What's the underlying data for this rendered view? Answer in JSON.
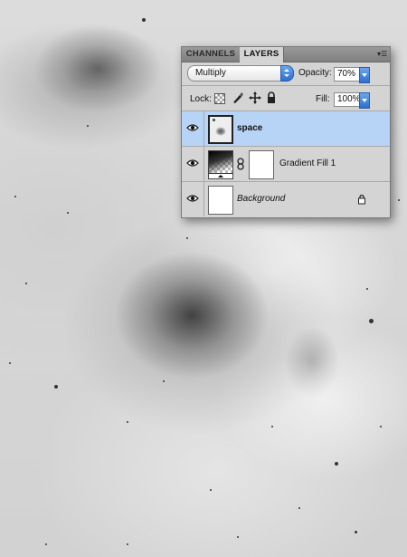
{
  "panel": {
    "tabs": [
      "CHANNELS",
      "LAYERS"
    ],
    "active_tab": "LAYERS",
    "blend_mode": "Multiply",
    "opacity_label": "Opacity:",
    "opacity_value": "70%",
    "lock_label": "Lock:",
    "fill_label": "Fill:",
    "fill_value": "100%",
    "menu_icon": "panel-menu-icon",
    "layers": [
      {
        "name": "space",
        "selected": true,
        "visible": true,
        "thumbnail": "image-thumbnail"
      },
      {
        "name": "Gradient Fill 1",
        "selected": false,
        "visible": true,
        "thumbnail": "gradient-thumbnail",
        "has_mask": true
      },
      {
        "name": "Background",
        "selected": false,
        "visible": true,
        "thumbnail": "white-thumbnail",
        "locked": true
      }
    ]
  },
  "colors": {
    "selection": "#b7d4f7",
    "panel_bg": "#d4d4d4",
    "accent": "#2c6fd1"
  }
}
